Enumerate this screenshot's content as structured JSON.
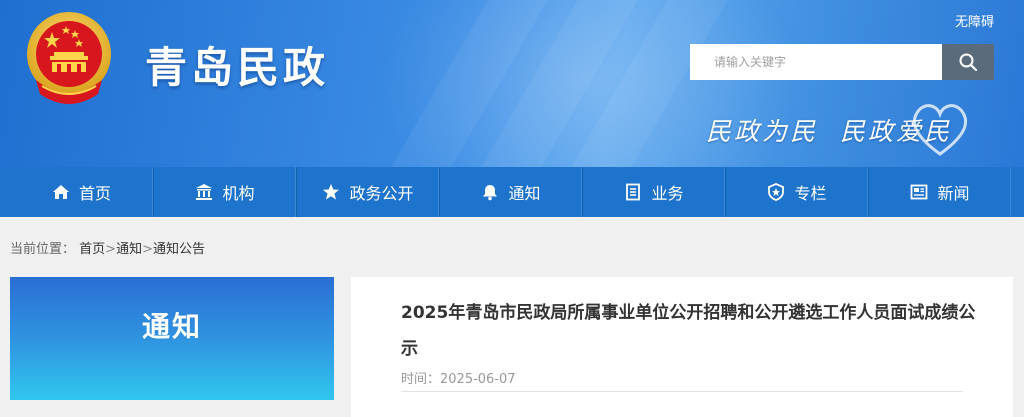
{
  "header": {
    "site_title": "青岛民政",
    "accessibility_label": "无障碍",
    "search_placeholder": "请输入关键字",
    "slogan_left": "民政为民",
    "slogan_right": "民政爱民"
  },
  "nav": {
    "items": [
      {
        "label": "首页",
        "icon": "home-icon"
      },
      {
        "label": "机构",
        "icon": "building-icon"
      },
      {
        "label": "政务公开",
        "icon": "star-icon"
      },
      {
        "label": "通知",
        "icon": "bell-icon"
      },
      {
        "label": "业务",
        "icon": "document-icon"
      },
      {
        "label": "专栏",
        "icon": "badge-icon"
      },
      {
        "label": "新闻",
        "icon": "news-icon"
      }
    ]
  },
  "breadcrumb": {
    "prefix": "当前位置：",
    "items": [
      "首页",
      "通知",
      "通知公告"
    ],
    "separator": ">"
  },
  "sidebar": {
    "title": "通知"
  },
  "article": {
    "title": "2025年青岛市民政局所属事业单位公开招聘和公开遴选工作人员面试成绩公示",
    "time_label": "时间：",
    "date": "2025-06-07"
  },
  "colors": {
    "nav_bg": "#1e73cc",
    "search_button": "#5a6b7c",
    "banner": "#3d8ee6"
  }
}
